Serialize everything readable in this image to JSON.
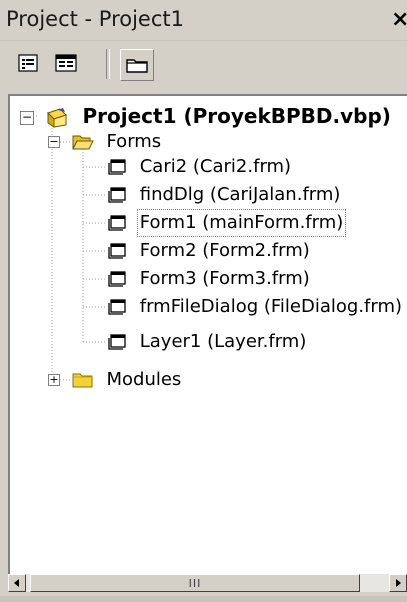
{
  "window": {
    "title": "Project - Project1",
    "close_label": "×"
  },
  "toolbar": {
    "buttons": [
      {
        "name": "view-code",
        "icon": "view-code-icon"
      },
      {
        "name": "view-object",
        "icon": "view-object-icon"
      },
      {
        "name": "toggle-folders",
        "icon": "folder-icon"
      }
    ]
  },
  "tree": {
    "root": {
      "label": "Project1 (ProyekBPBD.vbp)",
      "expander": "⊟"
    },
    "forms_folder": {
      "label": "Forms",
      "expander": "⊟"
    },
    "forms": [
      {
        "label": "Cari2 (Cari2.frm)",
        "selected": false
      },
      {
        "label": "findDlg (CariJalan.frm)",
        "selected": false
      },
      {
        "label": "Form1 (mainForm.frm)",
        "selected": true
      },
      {
        "label": "Form2 (Form2.frm)",
        "selected": false
      },
      {
        "label": "Form3 (Form3.frm)",
        "selected": false
      },
      {
        "label": "frmFileDialog (FileDialog.frm)",
        "selected": false
      },
      {
        "label": "Layer1 (Layer.frm)",
        "selected": false
      }
    ],
    "modules_folder": {
      "label": "Modules",
      "expander": "⊞"
    }
  },
  "scrollbar": {
    "thumb_label": "III"
  },
  "colors": {
    "background": "#d4d0c8",
    "folder": "#f2d23a",
    "tree_bg": "#ffffff"
  }
}
